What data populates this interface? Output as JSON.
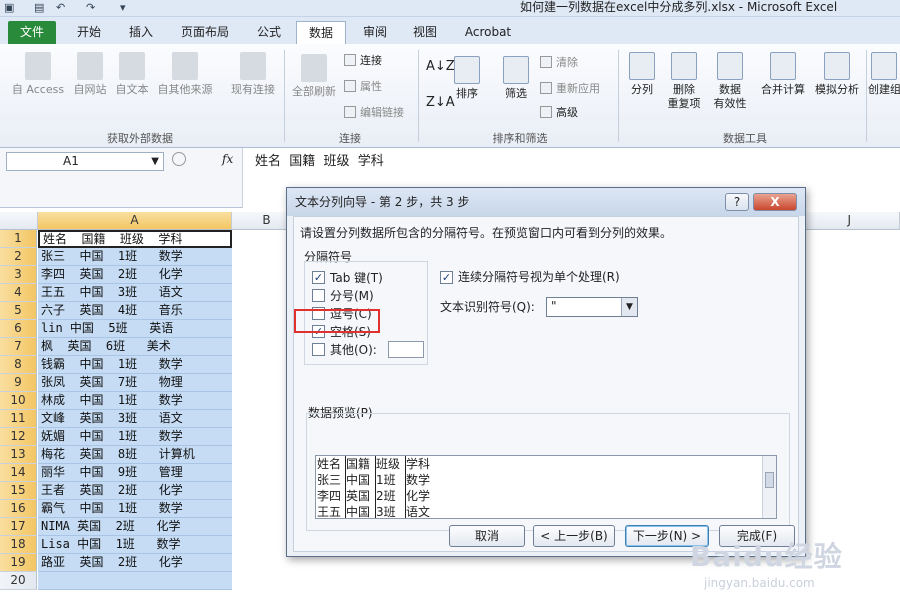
{
  "window": {
    "title": "如何建一列数据在excel中分成多列.xlsx - Microsoft Excel"
  },
  "tabs": [
    "文件",
    "开始",
    "插入",
    "页面布局",
    "公式",
    "数据",
    "审阅",
    "视图",
    "Acrobat"
  ],
  "ribbon": {
    "get_external": {
      "items": [
        "自 Access",
        "自网站",
        "自文本",
        "自其他来源",
        "现有连接"
      ],
      "group": "获取外部数据"
    },
    "connections": {
      "refresh": "全部刷新",
      "items": [
        "连接",
        "属性",
        "编辑链接"
      ],
      "group": "连接"
    },
    "sort_filter": {
      "sort": "排序",
      "filter": "筛选",
      "items": [
        "清除",
        "重新应用",
        "高级"
      ],
      "group": "排序和筛选"
    },
    "data_tools": {
      "split": "分列",
      "dedupe_1": "删除",
      "dedupe_2": "重复项",
      "validate_1": "数据",
      "validate_2": "有效性",
      "consolidate": "合并计算",
      "whatif": "模拟分析",
      "group": "数据工具"
    },
    "outline": {
      "create": "创建组"
    }
  },
  "formula_bar": {
    "name_box": "A1",
    "fx": "fx",
    "content": "姓名  国籍  班级  学科"
  },
  "sheet": {
    "columns": [
      "A",
      "B",
      "J"
    ],
    "rows": [
      "1",
      "2",
      "3",
      "4",
      "5",
      "6",
      "7",
      "8",
      "9",
      "10",
      "11",
      "12",
      "13",
      "14",
      "15",
      "16",
      "17",
      "18",
      "19",
      "20"
    ],
    "cells": [
      "姓名  国籍  班级  学科",
      "张三  中国  1班   数学",
      "李四  英国  2班   化学",
      "王五  中国  3班   语文",
      "六子  英国  4班   音乐",
      "lin 中国  5班   英语",
      "枫  英国  6班   美术",
      "钱霸  中国  1班   数学",
      "张凤  英国  7班   物理",
      "林成  中国  1班   数学",
      "文峰  英国  3班   语文",
      "妩媚  中国  1班   数学",
      "梅花  英国  8班   计算机",
      "丽华  中国  9班   管理",
      "王者  英国  2班   化学",
      "霸气  中国  1班   数学",
      "NIMA 英国  2班   化学",
      "Lisa 中国  1班   数学",
      "路亚  英国  2班   化学",
      ""
    ]
  },
  "dialog": {
    "title": "文本分列向导 - 第 2 步，共 3 步",
    "help": "?",
    "close": "X",
    "instruction": "请设置分列数据所包含的分隔符号。在预览窗口内可看到分列的效果。",
    "delimiters_label": "分隔符号",
    "options": [
      {
        "label": "Tab 键(T)",
        "checked": true
      },
      {
        "label": "分号(M)",
        "checked": false
      },
      {
        "label": "逗号(C)",
        "checked": false
      },
      {
        "label": "空格(S)",
        "checked": true
      },
      {
        "label": "其他(O):",
        "checked": false
      }
    ],
    "consecutive_label": "连续分隔符号视为单个处理(R)",
    "consecutive_checked": true,
    "qualifier_label": "文本识别符号(Q):",
    "qualifier_value": "\"",
    "preview_label": "数据预览(P)",
    "preview": [
      [
        "姓名",
        "国籍",
        "班级",
        "学科"
      ],
      [
        "张三",
        "中国",
        "1班",
        "数学"
      ],
      [
        "李四",
        "英国",
        "2班",
        "化学"
      ],
      [
        "王五",
        "中国",
        "3班",
        "语文"
      ]
    ],
    "buttons": {
      "cancel": "取消",
      "back": "< 上一步(B)",
      "next": "下一步(N) >",
      "finish": "完成(F)"
    }
  },
  "watermark": {
    "text": "Baidu经验",
    "url": "jingyan.baidu.com"
  },
  "colors": {
    "file_tab": "#2a8a3c",
    "selection": "#c5dcf4",
    "highlight": "#e0312f"
  }
}
